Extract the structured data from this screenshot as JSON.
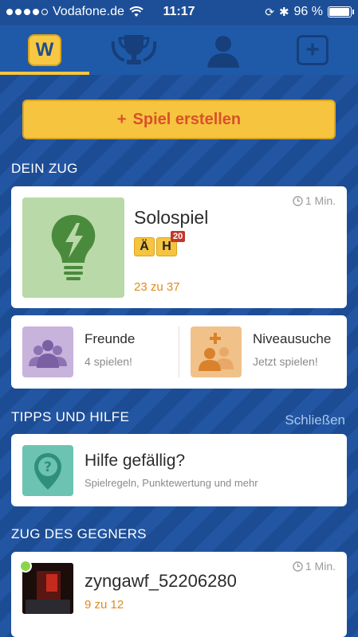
{
  "status": {
    "carrier": "Vodafone.de",
    "time": "11:17",
    "battery_text": "96 %",
    "battery_level": 0.96
  },
  "nav": {
    "items": [
      {
        "name": "home",
        "label": "W",
        "active": true
      },
      {
        "name": "trophy",
        "active": false
      },
      {
        "name": "profile",
        "active": false
      },
      {
        "name": "new-game",
        "active": false
      }
    ]
  },
  "create_button": {
    "icon": "+",
    "label": "Spiel erstellen"
  },
  "your_turn": {
    "title": "DEIN ZUG",
    "solo": {
      "title": "Solospiel",
      "time": "1 Min.",
      "tiles": [
        "Ä",
        "H"
      ],
      "tile_badge": "20",
      "score": "23 zu 37"
    }
  },
  "play_options": {
    "friends": {
      "label": "Freunde",
      "sub": "4 spielen!"
    },
    "level_search": {
      "label": "Niveausuche",
      "sub": "Jetzt spielen!"
    }
  },
  "tips": {
    "title": "TIPPS UND HILFE",
    "close_label": "Schließen",
    "help_title": "Hilfe gefällig?",
    "help_sub": "Spielregeln, Punktewertung und mehr"
  },
  "opponent_turn": {
    "title": "ZUG DES GEGNERS",
    "game": {
      "name": "zyngawf_52206280",
      "time": "1 Min.",
      "score": "9 zu 12"
    }
  },
  "colors": {
    "accent_yellow": "#f6c43f",
    "accent_orange": "#e08a1e",
    "nav_blue": "#1f5aa8",
    "bg_blue": "#1d4f98"
  }
}
